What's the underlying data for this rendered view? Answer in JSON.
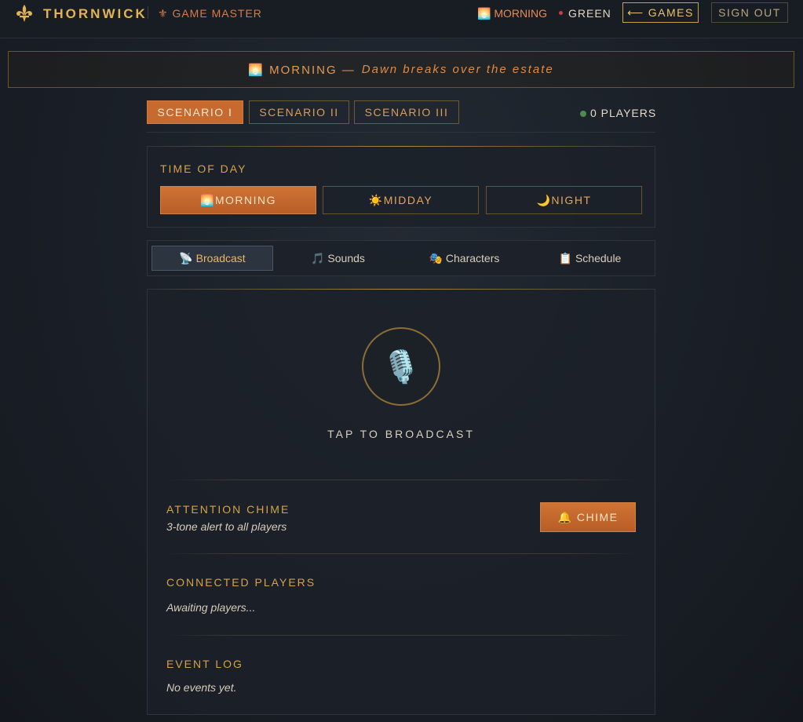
{
  "header": {
    "brand": "THORNWICK",
    "role": "GAME MASTER",
    "role_icon": "⚜",
    "time_indicator": "🌅 MORNING",
    "status": "GREEN",
    "games_button": "GAMES",
    "games_arrow": "⟵",
    "signout_button": "SIGN OUT"
  },
  "banner": {
    "prefix": "🌅 MORNING —",
    "subtitle": "Dawn breaks over the estate"
  },
  "scenarios": {
    "tabs": [
      "SCENARIO I",
      "SCENARIO II",
      "SCENARIO III"
    ],
    "active": 0,
    "players": "0 PLAYERS"
  },
  "time_of_day": {
    "title": "TIME OF DAY",
    "options": [
      "🌅MORNING",
      "☀️MIDDAY",
      "🌙NIGHT"
    ],
    "active": 0
  },
  "modes": {
    "tabs": [
      "📡 Broadcast",
      "🎵 Sounds",
      "🎭 Characters",
      "📋 Schedule"
    ],
    "active": 0
  },
  "broadcast": {
    "mic_icon": "🎙️",
    "tap_label": "TAP TO BROADCAST"
  },
  "chime": {
    "title": "ATTENTION CHIME",
    "description": "3-tone alert to all players",
    "button": "🔔 CHIME"
  },
  "connected": {
    "title": "CONNECTED PLAYERS",
    "empty": "Awaiting players..."
  },
  "event_log": {
    "title": "EVENT LOG",
    "empty": "No events yet."
  },
  "colors": {
    "accent": "#c66a30",
    "gold": "#e2b552",
    "status_red": "#c7413a",
    "online_green": "#4d8a4f"
  }
}
